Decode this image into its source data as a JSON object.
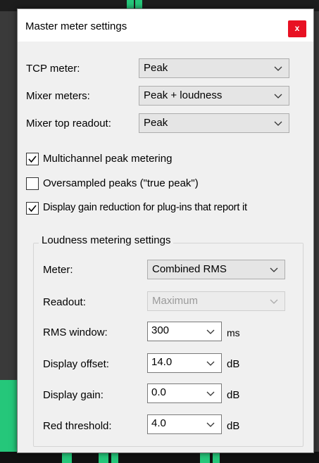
{
  "dialog": {
    "title": "Master meter settings",
    "close_glyph": "x"
  },
  "tcp_meter": {
    "label": "TCP meter:",
    "value": "Peak"
  },
  "mixer_meters": {
    "label": "Mixer meters:",
    "value": "Peak + loudness"
  },
  "mixer_top_readout": {
    "label": "Mixer top readout:",
    "value": "Peak"
  },
  "checkboxes": {
    "multichannel": {
      "label": "Multichannel peak metering",
      "checked": true
    },
    "oversampled": {
      "label": "Oversampled peaks (\"true peak\")",
      "checked": false
    },
    "gain_reduction": {
      "label": "Display gain reduction for plug-ins that report it",
      "checked": true
    }
  },
  "loudness": {
    "group_title": "Loudness metering settings",
    "meter": {
      "label": "Meter:",
      "value": "Combined RMS"
    },
    "readout": {
      "label": "Readout:",
      "value": "Maximum",
      "disabled": true
    },
    "rms_window": {
      "label": "RMS window:",
      "value": "300",
      "unit": "ms"
    },
    "display_offset": {
      "label": "Display offset:",
      "value": "14.0",
      "unit": "dB"
    },
    "display_gain": {
      "label": "Display gain:",
      "value": "0.0",
      "unit": "dB"
    },
    "red_threshold": {
      "label": "Red threshold:",
      "value": "4.0",
      "unit": "dB"
    }
  },
  "colors": {
    "accent_green": "#25c77a",
    "close_red": "#e81123",
    "dialog_bg": "#f0f0f0"
  }
}
